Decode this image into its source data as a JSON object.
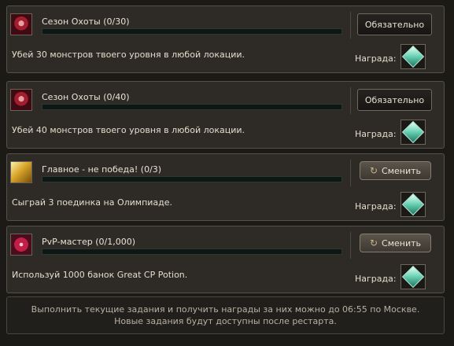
{
  "quests": [
    {
      "icon": "demon-mask-icon",
      "title": "Сезон Охоты (0/30)",
      "progress": 0,
      "description": "Убей 30 монстров твоего уровня в любой локации.",
      "button": {
        "label": "Обязательно",
        "icon": ""
      },
      "reward_label": "Награда:",
      "reward_icon": "green-gem-icon"
    },
    {
      "icon": "demon-mask-icon",
      "title": "Сезон Охоты (0/40)",
      "progress": 0,
      "description": "Убей 40 монстров твоего уровня в любой локации.",
      "button": {
        "label": "Обязательно",
        "icon": ""
      },
      "reward_label": "Награда:",
      "reward_icon": "green-gem-icon"
    },
    {
      "icon": "golden-wings-icon",
      "title": "Главное - не победа! (0/3)",
      "progress": 0,
      "description": "Сыграй 3 поединка на Олимпиаде.",
      "button": {
        "label": "Сменить",
        "icon": "refresh-icon"
      },
      "reward_label": "Награда:",
      "reward_icon": "green-gem-icon"
    },
    {
      "icon": "pvp-emblem-icon",
      "title": "PvP-мастер (0/1,000)",
      "progress": 0,
      "description": "Используй 1000 банок Great CP Potion.",
      "button": {
        "label": "Сменить",
        "icon": "refresh-icon"
      },
      "reward_label": "Награда:",
      "reward_icon": "green-gem-icon"
    }
  ],
  "footer": {
    "line1": "Выполнить текущие задания и получить награды за них можно до 06:55 по Москве.",
    "line2": "Новые задания будут доступны после рестарта."
  },
  "colors": {
    "panel_bg": "#2e2a25",
    "panel_border": "#55504a",
    "progress_fill": "#2e9e74",
    "gem": "#71d6b9"
  }
}
